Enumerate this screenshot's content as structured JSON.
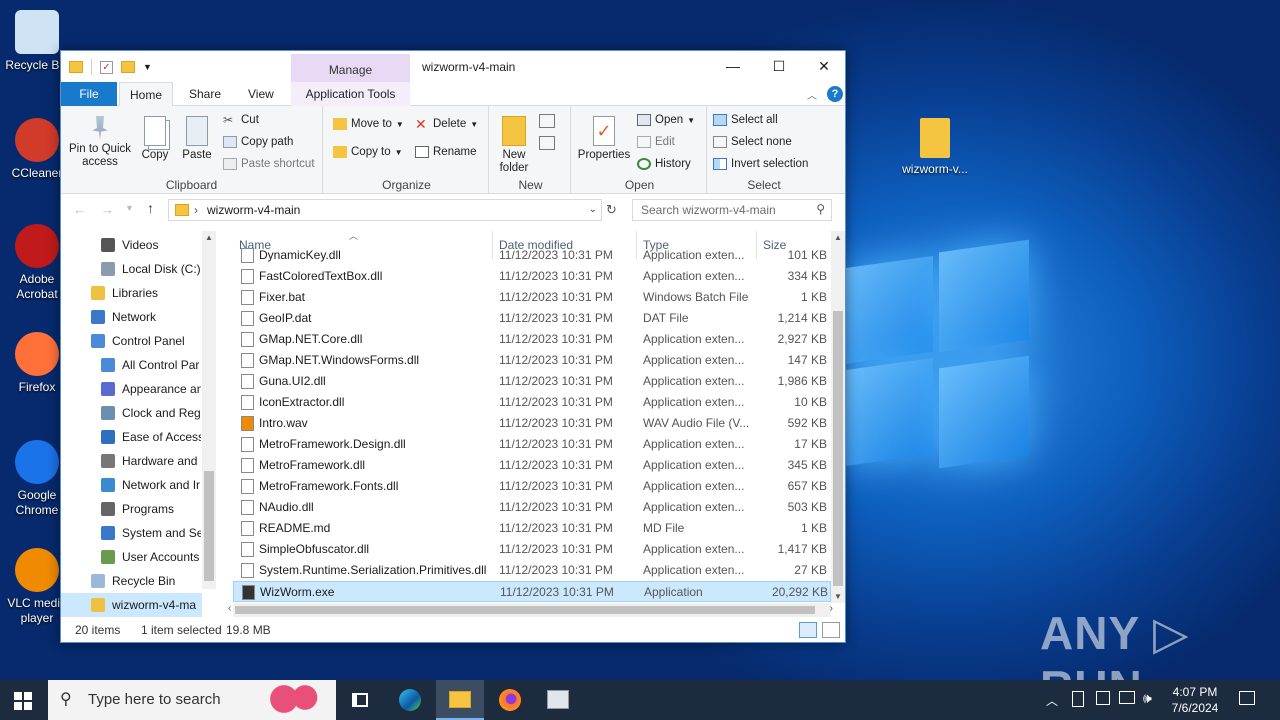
{
  "desktop": {
    "icons": [
      {
        "label": "Recycle Bin",
        "color": "#cfe3f5"
      },
      {
        "label": "CCleaner",
        "color": "#d23a2a"
      },
      {
        "label": "Adobe Acrobat",
        "color": "#c11a1a"
      },
      {
        "label": "Firefox",
        "color": "#ff7139"
      },
      {
        "label": "Google Chrome",
        "color": "#1a73e8"
      },
      {
        "label": "VLC media player",
        "color": "#f08a00"
      }
    ],
    "folder_label": "wizworm-v...",
    "watermark": "ANY ▷ RUN"
  },
  "window": {
    "title": "wizworm-v4-main",
    "manage_tab": "Manage",
    "tabs": {
      "file": "File",
      "home": "Home",
      "share": "Share",
      "view": "View",
      "app_tools": "Application Tools"
    },
    "controls": {
      "minimize": "—",
      "maximize": "☐",
      "close": "✕"
    }
  },
  "ribbon": {
    "clipboard": {
      "label": "Clipboard",
      "pin": "Pin to Quick access",
      "copy": "Copy",
      "paste": "Paste",
      "cut": "Cut",
      "copy_path": "Copy path",
      "paste_shortcut": "Paste shortcut"
    },
    "organize": {
      "label": "Organize",
      "move_to": "Move to",
      "copy_to": "Copy to",
      "delete": "Delete",
      "rename": "Rename"
    },
    "new": {
      "label": "New",
      "new_folder": "New folder"
    },
    "open": {
      "label": "Open",
      "properties": "Properties",
      "open": "Open",
      "edit": "Edit",
      "history": "History"
    },
    "select": {
      "label": "Select",
      "select_all": "Select all",
      "select_none": "Select none",
      "invert": "Invert selection"
    }
  },
  "address": {
    "path": "wizworm-v4-main",
    "search_placeholder": "Search wizworm-v4-main"
  },
  "nav": {
    "items": [
      {
        "label": "Videos",
        "color": "#555"
      },
      {
        "label": "Local Disk (C:)",
        "color": "#8a9bb0"
      },
      {
        "label": "Libraries",
        "color": "#f0c040"
      },
      {
        "label": "Network",
        "color": "#3a78c9"
      },
      {
        "label": "Control Panel",
        "color": "#4a8ad6"
      },
      {
        "label": "All Control Par",
        "color": "#4a8ad6"
      },
      {
        "label": "Appearance an",
        "color": "#5a6bd0"
      },
      {
        "label": "Clock and Regi",
        "color": "#6b8fb0"
      },
      {
        "label": "Ease of Access",
        "color": "#2e70c0"
      },
      {
        "label": "Hardware and",
        "color": "#777"
      },
      {
        "label": "Network and Ir",
        "color": "#3a8ad0"
      },
      {
        "label": "Programs",
        "color": "#666"
      },
      {
        "label": "System and Sec",
        "color": "#3a78c9"
      },
      {
        "label": "User Accounts",
        "color": "#6a9a50"
      },
      {
        "label": "Recycle Bin",
        "color": "#9ab8d8"
      },
      {
        "label": "wizworm-v4-ma",
        "color": "#f0c040"
      }
    ]
  },
  "files": {
    "headers": {
      "name": "Name",
      "date": "Date modified",
      "type": "Type",
      "size": "Size"
    },
    "rows": [
      {
        "name": "DynamicKey.dll",
        "date": "11/12/2023 10:31 PM",
        "type": "Application exten...",
        "size": "101 KB"
      },
      {
        "name": "FastColoredTextBox.dll",
        "date": "11/12/2023 10:31 PM",
        "type": "Application exten...",
        "size": "334 KB"
      },
      {
        "name": "Fixer.bat",
        "date": "11/12/2023 10:31 PM",
        "type": "Windows Batch File",
        "size": "1 KB"
      },
      {
        "name": "GeoIP.dat",
        "date": "11/12/2023 10:31 PM",
        "type": "DAT File",
        "size": "1,214 KB"
      },
      {
        "name": "GMap.NET.Core.dll",
        "date": "11/12/2023 10:31 PM",
        "type": "Application exten...",
        "size": "2,927 KB"
      },
      {
        "name": "GMap.NET.WindowsForms.dll",
        "date": "11/12/2023 10:31 PM",
        "type": "Application exten...",
        "size": "147 KB"
      },
      {
        "name": "Guna.UI2.dll",
        "date": "11/12/2023 10:31 PM",
        "type": "Application exten...",
        "size": "1,986 KB"
      },
      {
        "name": "IconExtractor.dll",
        "date": "11/12/2023 10:31 PM",
        "type": "Application exten...",
        "size": "10 KB"
      },
      {
        "name": "Intro.wav",
        "date": "11/12/2023 10:31 PM",
        "type": "WAV Audio File (V...",
        "size": "592 KB"
      },
      {
        "name": "MetroFramework.Design.dll",
        "date": "11/12/2023 10:31 PM",
        "type": "Application exten...",
        "size": "17 KB"
      },
      {
        "name": "MetroFramework.dll",
        "date": "11/12/2023 10:31 PM",
        "type": "Application exten...",
        "size": "345 KB"
      },
      {
        "name": "MetroFramework.Fonts.dll",
        "date": "11/12/2023 10:31 PM",
        "type": "Application exten...",
        "size": "657 KB"
      },
      {
        "name": "NAudio.dll",
        "date": "11/12/2023 10:31 PM",
        "type": "Application exten...",
        "size": "503 KB"
      },
      {
        "name": "README.md",
        "date": "11/12/2023 10:31 PM",
        "type": "MD File",
        "size": "1 KB"
      },
      {
        "name": "SimpleObfuscator.dll",
        "date": "11/12/2023 10:31 PM",
        "type": "Application exten...",
        "size": "1,417 KB"
      },
      {
        "name": "System.Runtime.Serialization.Primitives.dll",
        "date": "11/12/2023 10:31 PM",
        "type": "Application exten...",
        "size": "27 KB"
      },
      {
        "name": "WizWorm.exe",
        "date": "11/12/2023 10:31 PM",
        "type": "Application",
        "size": "20,292 KB"
      }
    ]
  },
  "status": {
    "count": "20 items",
    "selected": "1 item selected",
    "size": "19.8 MB"
  },
  "taskbar": {
    "search_placeholder": "Type here to search",
    "time": "4:07 PM",
    "date": "7/6/2024"
  },
  "colors": {
    "accent": "#1979ca",
    "selection": "#cce8ff",
    "taskbar": "#1c2b3d"
  }
}
